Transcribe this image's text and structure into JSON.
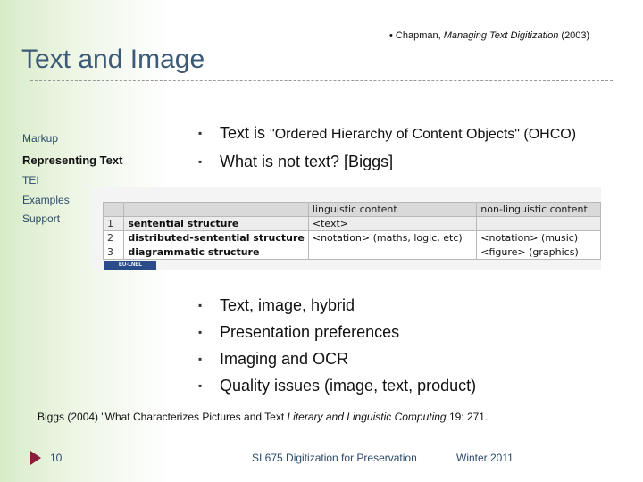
{
  "slide": {
    "citation_prefix": "• Chapman, ",
    "citation_title": "Managing Text Digitization",
    "citation_year": " (2003)",
    "title": "Text and Image"
  },
  "nav": {
    "items": [
      {
        "label": "Markup"
      },
      {
        "label": "Representing Text"
      },
      {
        "label": "TEI"
      },
      {
        "label": "Examples"
      },
      {
        "label": "Support"
      }
    ]
  },
  "bullets_top": [
    {
      "prefix": "Text is ",
      "ohco": "\"Ordered Hierarchy of Content Objects\" (OHCO)"
    },
    {
      "text": "What is not text? [Biggs]"
    }
  ],
  "table": {
    "headers": [
      "",
      "",
      "linguistic content",
      "non-linguistic content"
    ],
    "rows": [
      [
        "1",
        "sentential structure",
        "<text>",
        ""
      ],
      [
        "2",
        "distributed-sentential structure",
        "<notation> (maths, logic, etc)",
        "<notation> (music)"
      ],
      [
        "3",
        "diagrammatic structure",
        "",
        "<figure> (graphics)"
      ]
    ],
    "logo_text": "EU-LNEL"
  },
  "bullets_bottom": [
    "Text, image, hybrid",
    "Presentation preferences",
    "Imaging and OCR",
    "Quality issues (image, text, product)"
  ],
  "reference": {
    "prefix": "Biggs (2004)  \"What Characterizes Pictures and Text ",
    "journal": "Literary and Linguistic Computing",
    "suffix": " 19: 271."
  },
  "footer": {
    "page_number": "10",
    "course": "SI 675 Digitization for Preservation",
    "term": "Winter 2011"
  }
}
